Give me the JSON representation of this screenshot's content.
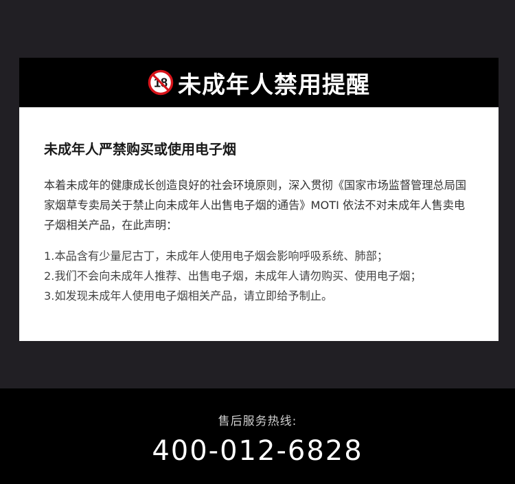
{
  "notice": {
    "badge_number": "18",
    "title": "未成年人禁用提醒",
    "heading": "未成年人严禁购买或使用电子烟",
    "intro": "本着未成年的健康成长创造良好的社会环境原则，深入贯彻《国家市场监督管理总局国家烟草专卖局关于禁止向未成年人出售电子烟的通告》MOTI 依法不对未成年人售卖电子烟相关产品，在此声明：",
    "points": [
      "1.本品含有少量尼古丁，未成年人使用电子烟会影响呼吸系统、肺部；",
      "2.我们不会向未成年人推荐、出售电子烟，未成年人请勿购买、使用电子烟；",
      "3.如发现未成年人使用电子烟相关产品，请立即给予制止。"
    ]
  },
  "footer": {
    "hotline_label": "售后服务热线:",
    "hotline_number": "400-012-6828"
  },
  "colors": {
    "page_background": "#211f24",
    "header_background": "#000000",
    "badge_red": "#d7141a"
  },
  "icons": {
    "age_badge": "no-under-18-icon"
  }
}
